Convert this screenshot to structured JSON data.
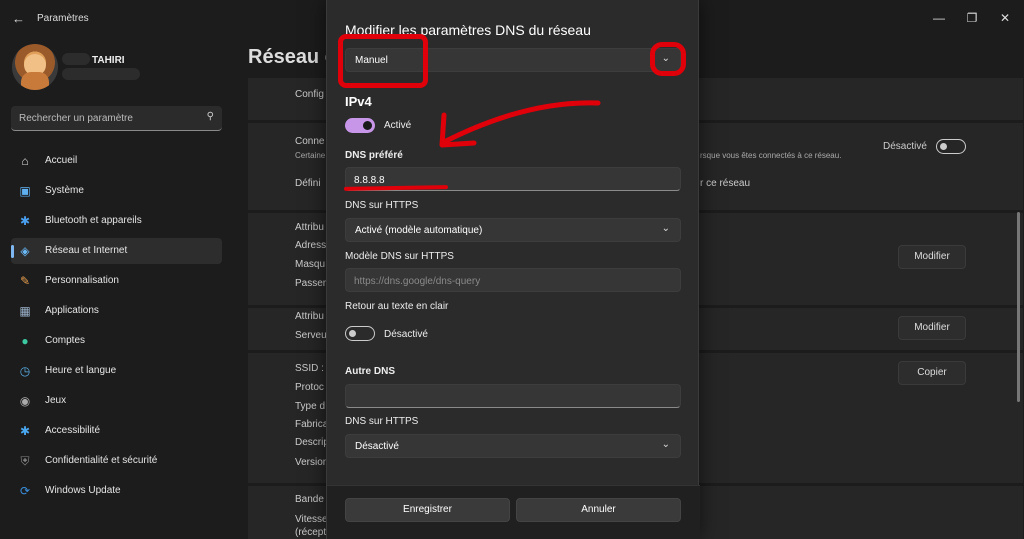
{
  "window": {
    "title": "Paramètres"
  },
  "profile": {
    "name": "TAHIRI"
  },
  "search": {
    "placeholder": "Rechercher un paramètre"
  },
  "sidebar": {
    "items": [
      {
        "label": "Accueil",
        "icon": "home-icon"
      },
      {
        "label": "Système",
        "icon": "system-icon"
      },
      {
        "label": "Bluetooth et appareils",
        "icon": "bluetooth-icon"
      },
      {
        "label": "Réseau et Internet",
        "icon": "wifi-icon",
        "active": true
      },
      {
        "label": "Personnalisation",
        "icon": "brush-icon"
      },
      {
        "label": "Applications",
        "icon": "apps-icon"
      },
      {
        "label": "Comptes",
        "icon": "account-icon"
      },
      {
        "label": "Heure et langue",
        "icon": "clock-globe-icon"
      },
      {
        "label": "Jeux",
        "icon": "gamepad-icon"
      },
      {
        "label": "Accessibilité",
        "icon": "accessibility-icon"
      },
      {
        "label": "Confidentialité et sécurité",
        "icon": "shield-icon"
      },
      {
        "label": "Windows Update",
        "icon": "update-icon"
      }
    ]
  },
  "main": {
    "title": "Réseau e",
    "rows": {
      "config": "Config",
      "conn": "Conne",
      "conn_desc": "Certaine",
      "conn_desc_right": "rsque vous êtes connectés à ce réseau.",
      "define": "Défini",
      "define_right": "r ce réseau",
      "toggle_label": "Désactivé",
      "attrib1": "Attribu",
      "adresse": "Adress",
      "masque": "Masqu",
      "passerelle": "Passere",
      "attrib2": "Attribu",
      "serveur": "Serveu",
      "ssid": "SSID :",
      "proto": "Protoc",
      "type": "Type d",
      "fabric": "Fabrica",
      "descrip": "Descrip",
      "version": "Version",
      "bande": "Bande",
      "vitesse": "Vitesse",
      "reception": "(récept"
    },
    "buttons": {
      "modifier1": "Modifier",
      "modifier2": "Modifier",
      "copier": "Copier"
    }
  },
  "dialog": {
    "title": "Modifier les paramètres DNS du réseau",
    "mode_select": "Manuel",
    "ipv4_heading": "IPv4",
    "ipv4_toggle_label": "Activé",
    "preferred_dns_label": "DNS préféré",
    "preferred_dns_value": "8.8.8.8",
    "dns_https_label": "DNS sur HTTPS",
    "dns_https_value": "Activé (modèle automatique)",
    "dns_https_template_label": "Modèle DNS sur HTTPS",
    "dns_https_template_placeholder": "https://dns.google/dns-query",
    "fallback_label": "Retour au texte en clair",
    "fallback_toggle_label": "Désactivé",
    "alt_dns_label": "Autre DNS",
    "alt_dns_value": "",
    "alt_dns_https_label": "DNS sur HTTPS",
    "alt_dns_https_value": "Désactivé",
    "save_label": "Enregistrer",
    "cancel_label": "Annuler"
  },
  "colors": {
    "accent_toggle": "#c896e8",
    "annotation_red": "#e0000a",
    "nav_indicator": "#7fb8f0"
  }
}
